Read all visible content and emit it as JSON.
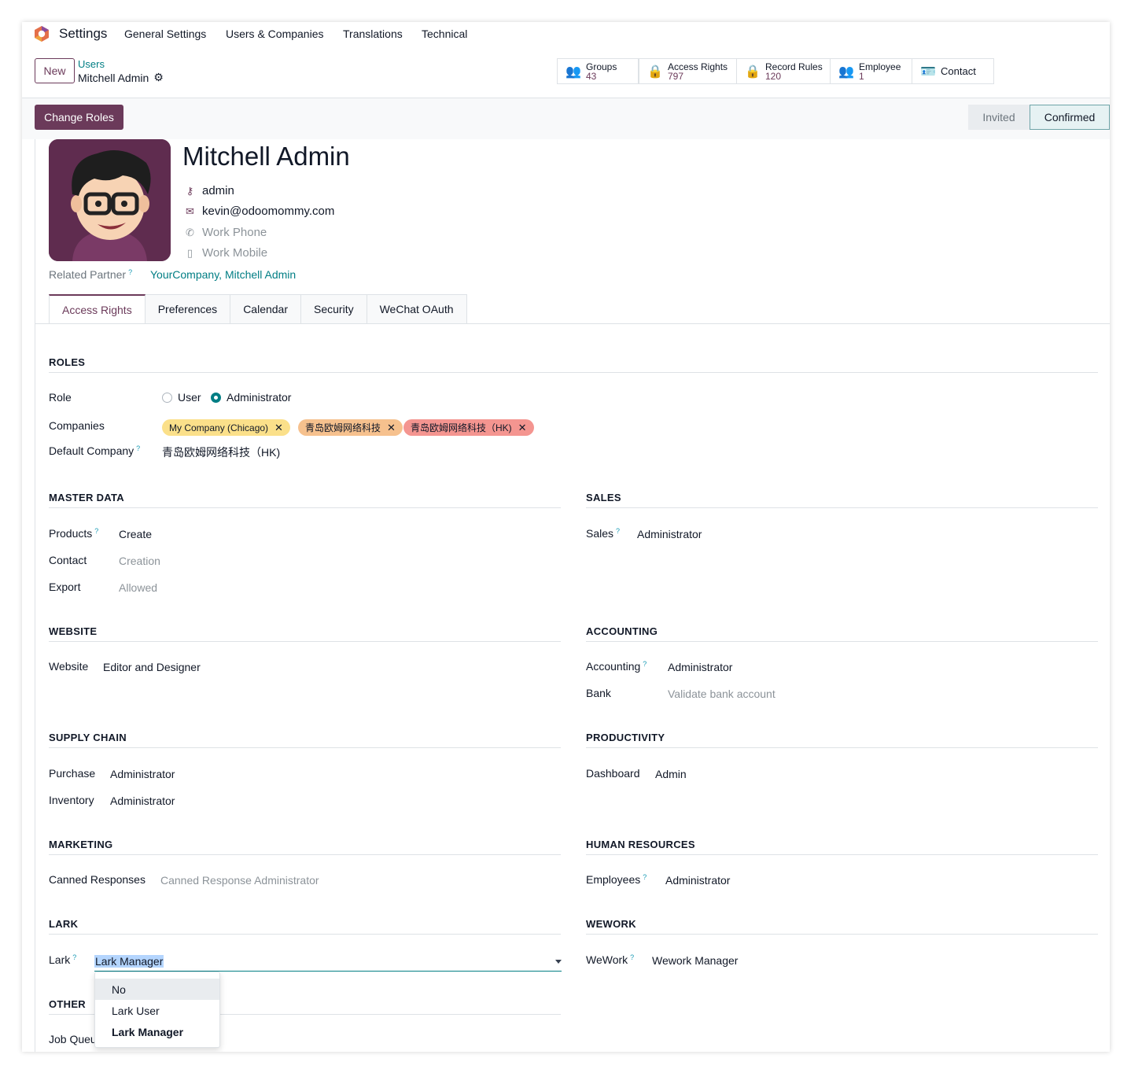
{
  "app": {
    "title": "Settings"
  },
  "nav": [
    "General Settings",
    "Users & Companies",
    "Translations",
    "Technical"
  ],
  "control_panel": {
    "new_label": "New",
    "breadcrumb_parent": "Users",
    "breadcrumb_current": "Mitchell Admin"
  },
  "smart_buttons": [
    {
      "label": "Groups",
      "value": "43",
      "icon": "users-icon"
    },
    {
      "label": "Access Rights",
      "value": "797",
      "icon": "lock-icon"
    },
    {
      "label": "Record Rules",
      "value": "120",
      "icon": "lock-icon"
    },
    {
      "label": "Employee",
      "value": "1",
      "icon": "users-icon"
    },
    {
      "label": "Contact",
      "value": "",
      "icon": "id-card-icon"
    }
  ],
  "statusbar": {
    "change_roles_label": "Change Roles",
    "stages": [
      "Invited",
      "Confirmed"
    ],
    "active_stage": "Confirmed"
  },
  "user": {
    "name": "Mitchell Admin",
    "login": "admin",
    "email": "kevin@odoomommy.com",
    "work_phone_placeholder": "Work Phone",
    "work_mobile_placeholder": "Work Mobile",
    "related_partner_label": "Related Partner",
    "related_partner": "YourCompany, Mitchell Admin"
  },
  "tabs": [
    "Access Rights",
    "Preferences",
    "Calendar",
    "Security",
    "WeChat OAuth"
  ],
  "active_tab": "Access Rights",
  "roles": {
    "section": "ROLES",
    "role_label": "Role",
    "role_options": [
      "User",
      "Administrator"
    ],
    "role_selected": "Administrator",
    "companies_label": "Companies",
    "companies": [
      {
        "name": "My Company (Chicago)",
        "color": "#fbe08a"
      },
      {
        "name": "青岛欧姆网络科技",
        "color": "#f6c18e"
      },
      {
        "name": "青岛欧姆网络科技（HK)",
        "color": "#f49590"
      }
    ],
    "default_company_label": "Default Company",
    "default_company": "青岛欧姆网络科技（HK)"
  },
  "sections": {
    "master_data": {
      "title": "MASTER DATA",
      "fields": [
        {
          "label": "Products",
          "value": "Create"
        },
        {
          "label": "Contact",
          "value": "Creation"
        },
        {
          "label": "Export",
          "value": "Allowed"
        }
      ]
    },
    "sales": {
      "title": "SALES",
      "fields": [
        {
          "label": "Sales",
          "value": "Administrator"
        }
      ]
    },
    "website": {
      "title": "WEBSITE",
      "fields": [
        {
          "label": "Website",
          "value": "Editor and Designer"
        }
      ]
    },
    "accounting": {
      "title": "ACCOUNTING",
      "fields": [
        {
          "label": "Accounting",
          "value": "Administrator"
        },
        {
          "label": "Bank",
          "value": "Validate bank account"
        }
      ]
    },
    "supply_chain": {
      "title": "SUPPLY CHAIN",
      "fields": [
        {
          "label": "Purchase",
          "value": "Administrator"
        },
        {
          "label": "Inventory",
          "value": "Administrator"
        }
      ]
    },
    "productivity": {
      "title": "PRODUCTIVITY",
      "fields": [
        {
          "label": "Dashboard",
          "value": "Admin"
        }
      ]
    },
    "marketing": {
      "title": "MARKETING",
      "fields": [
        {
          "label": "Canned Responses",
          "value": "Canned Response Administrator"
        }
      ]
    },
    "human_resources": {
      "title": "HUMAN RESOURCES",
      "fields": [
        {
          "label": "Employees",
          "value": "Administrator"
        }
      ]
    },
    "lark": {
      "title": "LARK",
      "fields": [
        {
          "label": "Lark",
          "value": "Lark Manager"
        }
      ]
    },
    "wework": {
      "title": "WEWORK",
      "fields": [
        {
          "label": "WeWork",
          "value": "Wework Manager"
        }
      ]
    },
    "other": {
      "title": "OTHER",
      "fields": [
        {
          "label": "Job Queu",
          "value": ""
        }
      ]
    }
  },
  "lark_dropdown": {
    "options": [
      "No",
      "Lark User",
      "Lark Manager"
    ],
    "highlighted": "No",
    "selected": "Lark Manager"
  },
  "colors": {
    "brand": "#6b3a5a",
    "link": "#017e84",
    "help": "#1a9bb5"
  }
}
